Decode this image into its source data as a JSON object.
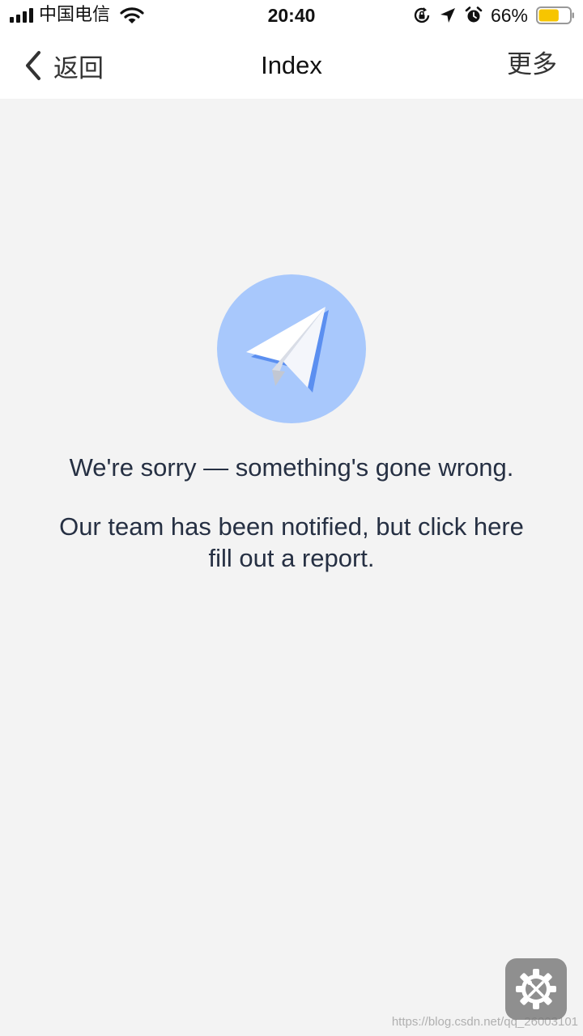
{
  "status_bar": {
    "carrier": "中国电信",
    "time": "20:40",
    "battery_percent": "66%",
    "battery_level": 0.66,
    "battery_color": "#f7c500",
    "icons": [
      "signal-icon",
      "wifi-icon",
      "rotation-lock-icon",
      "location-arrow-icon",
      "alarm-icon",
      "battery-icon"
    ]
  },
  "nav": {
    "back_label": "返回",
    "title": "Index",
    "more_label": "更多"
  },
  "error": {
    "illustration_icon": "paper-plane-icon",
    "accent_color": "#a8c8fc",
    "headline": "We're sorry — something's gone wrong.",
    "report_line1": "Our team has been notified, but click here",
    "report_line2": "fill out a report."
  },
  "floating_button": {
    "icon": "settings-tools-icon"
  },
  "watermark": "https://blog.csdn.net/qq_26003101"
}
